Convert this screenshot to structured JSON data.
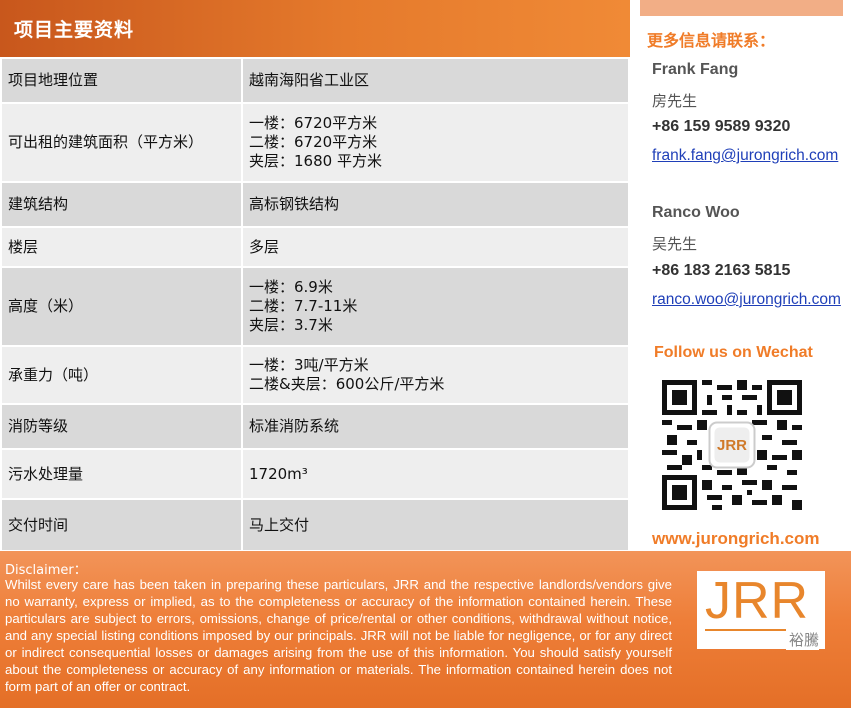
{
  "header": {
    "title": "项目主要资料"
  },
  "table": {
    "rows": [
      {
        "label": "项目地理位置",
        "lines": [
          "越南海阳省工业区"
        ]
      },
      {
        "label": "可出租的建筑面积（平方米）",
        "lines": [
          "一楼：6720平方米",
          "二楼：6720平方米",
          "夹层：1680 平方米"
        ]
      },
      {
        "label": "建筑结构",
        "lines": [
          "高标钢铁结构"
        ]
      },
      {
        "label": "楼层",
        "lines": [
          "多层"
        ]
      },
      {
        "label": "高度（米）",
        "lines": [
          "一楼：6.9米",
          "二楼：7.7-11米",
          "夹层：3.7米"
        ]
      },
      {
        "label": "承重力（吨）",
        "lines": [
          "一楼：3吨/平方米",
          "二楼&夹层：600公斤/平方米"
        ]
      },
      {
        "label": "消防等级",
        "lines": [
          "标准消防系统"
        ]
      },
      {
        "label": "污水处理量",
        "lines": [
          "1720m³"
        ]
      },
      {
        "label": "交付时间",
        "lines": [
          "马上交付"
        ]
      }
    ]
  },
  "sidebar": {
    "heading": "更多信息请联系：",
    "contacts": [
      {
        "name": "Frank Fang",
        "cn_name": "房先生",
        "phone": "+86 159 9589 9320",
        "email": "frank.fang@jurongrich.com"
      },
      {
        "name": "Ranco Woo",
        "cn_name": "吴先生",
        "phone": "+86 183 2163 5815",
        "email": "ranco.woo@jurongrich.com"
      }
    ],
    "follow": "Follow us on Wechat",
    "qr_center_text": "JRR",
    "website": "www.jurongrich.com"
  },
  "footer": {
    "disclaimer_title": "Disclaimer：",
    "disclaimer_text": "Whilst every care has been taken in preparing these particulars, JRR and the respective landlords/vendors give no warranty, express or implied, as to the completeness or accuracy of the information contained herein. These particulars are subject to errors, omissions, change of price/rental or other conditions, withdrawal without notice, and any special listing conditions imposed by our principals. JRR will not be liable for negligence, or for any direct or indirect consequential losses or damages arising from the use of this information. You should satisfy yourself about the completeness or accuracy of any information or materials. The information contained herein does not form part of an offer or contract.",
    "logo_text": "JRR",
    "logo_cn": "裕騰"
  },
  "colors": {
    "accent": "#f07c28",
    "header_dark": "#c8571c",
    "row_dark": "#d9d9d9",
    "row_light": "#eeeeee",
    "link": "#1f3fb8"
  }
}
